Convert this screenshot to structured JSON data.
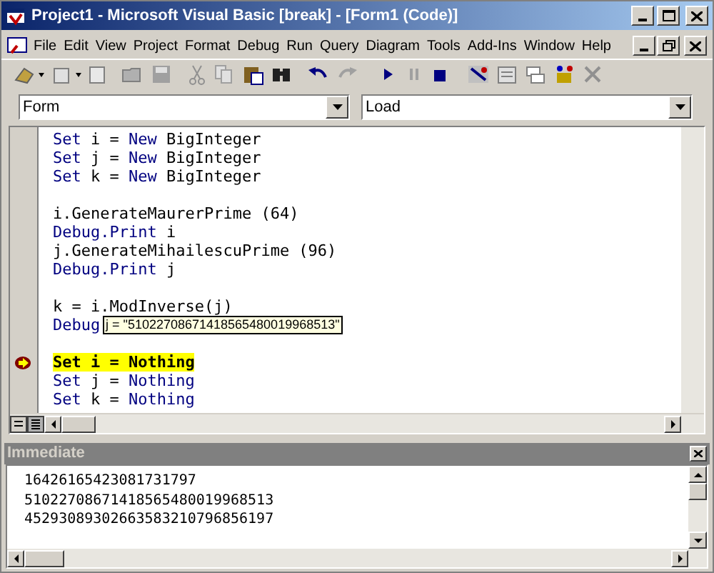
{
  "window": {
    "title": "Project1 - Microsoft Visual Basic [break] - [Form1 (Code)]"
  },
  "menu": [
    "File",
    "Edit",
    "View",
    "Project",
    "Format",
    "Debug",
    "Run",
    "Query",
    "Diagram",
    "Tools",
    "Add-Ins",
    "Window",
    "Help"
  ],
  "object_combo": {
    "value": "Form"
  },
  "procedure_combo": {
    "value": "Load"
  },
  "code_lines": [
    {
      "kind": "code",
      "current": false,
      "segments": [
        {
          "text": "Set",
          "kind": "keyword"
        },
        {
          "text": " i = ",
          "kind": "plain"
        },
        {
          "text": "New",
          "kind": "keyword"
        },
        {
          "text": " BigInteger",
          "kind": "plain"
        }
      ]
    },
    {
      "kind": "code",
      "current": false,
      "segments": [
        {
          "text": "Set",
          "kind": "keyword"
        },
        {
          "text": " j = ",
          "kind": "plain"
        },
        {
          "text": "New",
          "kind": "keyword"
        },
        {
          "text": " BigInteger",
          "kind": "plain"
        }
      ]
    },
    {
      "kind": "code",
      "current": false,
      "segments": [
        {
          "text": "Set",
          "kind": "keyword"
        },
        {
          "text": " k = ",
          "kind": "plain"
        },
        {
          "text": "New",
          "kind": "keyword"
        },
        {
          "text": " BigInteger",
          "kind": "plain"
        }
      ]
    },
    {
      "kind": "blank"
    },
    {
      "kind": "code",
      "current": false,
      "segments": [
        {
          "text": "i.GenerateMaurerPrime (64)",
          "kind": "plain"
        }
      ]
    },
    {
      "kind": "code",
      "current": false,
      "segments": [
        {
          "text": "Debug.Print",
          "kind": "keyword"
        },
        {
          "text": " i",
          "kind": "plain"
        }
      ]
    },
    {
      "kind": "code",
      "current": false,
      "segments": [
        {
          "text": "j.GenerateMihailescuPrime (96)",
          "kind": "plain"
        }
      ]
    },
    {
      "kind": "code",
      "current": false,
      "segments": [
        {
          "text": "Debug.Print",
          "kind": "keyword"
        },
        {
          "text": " j",
          "kind": "plain"
        }
      ]
    },
    {
      "kind": "blank"
    },
    {
      "kind": "code",
      "current": false,
      "segments": [
        {
          "text": "k = i.ModInverse(j)",
          "kind": "plain"
        }
      ]
    },
    {
      "kind": "code",
      "current": false,
      "segments": [
        {
          "text": "Debug",
          "kind": "keyword"
        }
      ],
      "tooltip": "j = \"51022708671418565480019968513\""
    },
    {
      "kind": "blank"
    },
    {
      "kind": "code",
      "current": true,
      "segments": [
        {
          "text": "Set i = Nothing",
          "kind": "current"
        }
      ]
    },
    {
      "kind": "code",
      "current": false,
      "segments": [
        {
          "text": "Set",
          "kind": "keyword"
        },
        {
          "text": " j = ",
          "kind": "plain"
        },
        {
          "text": "Nothing",
          "kind": "keyword"
        }
      ]
    },
    {
      "kind": "code",
      "current": false,
      "segments": [
        {
          "text": "Set",
          "kind": "keyword"
        },
        {
          "text": " k = ",
          "kind": "plain"
        },
        {
          "text": "Nothing",
          "kind": "keyword"
        }
      ]
    }
  ],
  "immediate": {
    "title": "Immediate",
    "lines": [
      "16426165423081731797",
      "51022708671418565480019968513",
      "45293089302663583210796856197"
    ]
  }
}
